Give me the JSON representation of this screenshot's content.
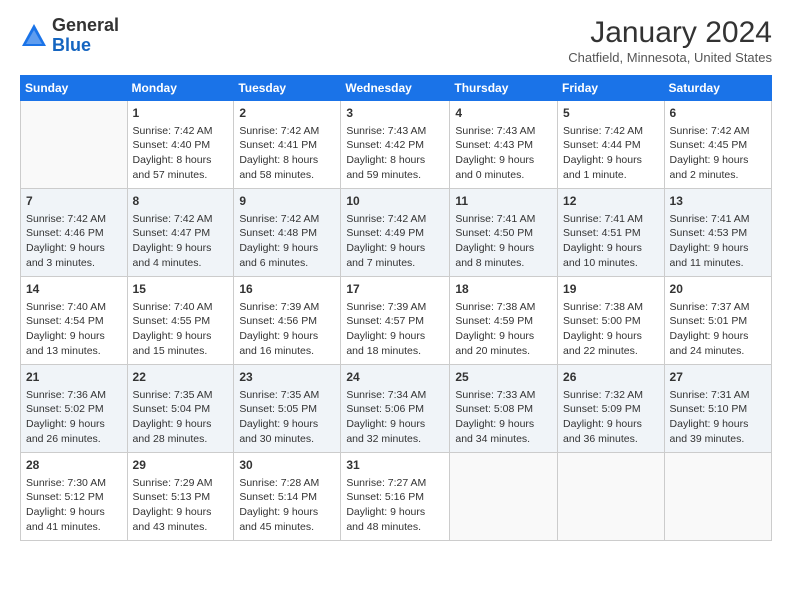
{
  "header": {
    "logo_general": "General",
    "logo_blue": "Blue",
    "month_title": "January 2024",
    "location": "Chatfield, Minnesota, United States"
  },
  "days_of_week": [
    "Sunday",
    "Monday",
    "Tuesday",
    "Wednesday",
    "Thursday",
    "Friday",
    "Saturday"
  ],
  "weeks": [
    [
      {
        "day": "",
        "content": ""
      },
      {
        "day": "1",
        "content": "Sunrise: 7:42 AM\nSunset: 4:40 PM\nDaylight: 8 hours\nand 57 minutes."
      },
      {
        "day": "2",
        "content": "Sunrise: 7:42 AM\nSunset: 4:41 PM\nDaylight: 8 hours\nand 58 minutes."
      },
      {
        "day": "3",
        "content": "Sunrise: 7:43 AM\nSunset: 4:42 PM\nDaylight: 8 hours\nand 59 minutes."
      },
      {
        "day": "4",
        "content": "Sunrise: 7:43 AM\nSunset: 4:43 PM\nDaylight: 9 hours\nand 0 minutes."
      },
      {
        "day": "5",
        "content": "Sunrise: 7:42 AM\nSunset: 4:44 PM\nDaylight: 9 hours\nand 1 minute."
      },
      {
        "day": "6",
        "content": "Sunrise: 7:42 AM\nSunset: 4:45 PM\nDaylight: 9 hours\nand 2 minutes."
      }
    ],
    [
      {
        "day": "7",
        "content": "Sunrise: 7:42 AM\nSunset: 4:46 PM\nDaylight: 9 hours\nand 3 minutes."
      },
      {
        "day": "8",
        "content": "Sunrise: 7:42 AM\nSunset: 4:47 PM\nDaylight: 9 hours\nand 4 minutes."
      },
      {
        "day": "9",
        "content": "Sunrise: 7:42 AM\nSunset: 4:48 PM\nDaylight: 9 hours\nand 6 minutes."
      },
      {
        "day": "10",
        "content": "Sunrise: 7:42 AM\nSunset: 4:49 PM\nDaylight: 9 hours\nand 7 minutes."
      },
      {
        "day": "11",
        "content": "Sunrise: 7:41 AM\nSunset: 4:50 PM\nDaylight: 9 hours\nand 8 minutes."
      },
      {
        "day": "12",
        "content": "Sunrise: 7:41 AM\nSunset: 4:51 PM\nDaylight: 9 hours\nand 10 minutes."
      },
      {
        "day": "13",
        "content": "Sunrise: 7:41 AM\nSunset: 4:53 PM\nDaylight: 9 hours\nand 11 minutes."
      }
    ],
    [
      {
        "day": "14",
        "content": "Sunrise: 7:40 AM\nSunset: 4:54 PM\nDaylight: 9 hours\nand 13 minutes."
      },
      {
        "day": "15",
        "content": "Sunrise: 7:40 AM\nSunset: 4:55 PM\nDaylight: 9 hours\nand 15 minutes."
      },
      {
        "day": "16",
        "content": "Sunrise: 7:39 AM\nSunset: 4:56 PM\nDaylight: 9 hours\nand 16 minutes."
      },
      {
        "day": "17",
        "content": "Sunrise: 7:39 AM\nSunset: 4:57 PM\nDaylight: 9 hours\nand 18 minutes."
      },
      {
        "day": "18",
        "content": "Sunrise: 7:38 AM\nSunset: 4:59 PM\nDaylight: 9 hours\nand 20 minutes."
      },
      {
        "day": "19",
        "content": "Sunrise: 7:38 AM\nSunset: 5:00 PM\nDaylight: 9 hours\nand 22 minutes."
      },
      {
        "day": "20",
        "content": "Sunrise: 7:37 AM\nSunset: 5:01 PM\nDaylight: 9 hours\nand 24 minutes."
      }
    ],
    [
      {
        "day": "21",
        "content": "Sunrise: 7:36 AM\nSunset: 5:02 PM\nDaylight: 9 hours\nand 26 minutes."
      },
      {
        "day": "22",
        "content": "Sunrise: 7:35 AM\nSunset: 5:04 PM\nDaylight: 9 hours\nand 28 minutes."
      },
      {
        "day": "23",
        "content": "Sunrise: 7:35 AM\nSunset: 5:05 PM\nDaylight: 9 hours\nand 30 minutes."
      },
      {
        "day": "24",
        "content": "Sunrise: 7:34 AM\nSunset: 5:06 PM\nDaylight: 9 hours\nand 32 minutes."
      },
      {
        "day": "25",
        "content": "Sunrise: 7:33 AM\nSunset: 5:08 PM\nDaylight: 9 hours\nand 34 minutes."
      },
      {
        "day": "26",
        "content": "Sunrise: 7:32 AM\nSunset: 5:09 PM\nDaylight: 9 hours\nand 36 minutes."
      },
      {
        "day": "27",
        "content": "Sunrise: 7:31 AM\nSunset: 5:10 PM\nDaylight: 9 hours\nand 39 minutes."
      }
    ],
    [
      {
        "day": "28",
        "content": "Sunrise: 7:30 AM\nSunset: 5:12 PM\nDaylight: 9 hours\nand 41 minutes."
      },
      {
        "day": "29",
        "content": "Sunrise: 7:29 AM\nSunset: 5:13 PM\nDaylight: 9 hours\nand 43 minutes."
      },
      {
        "day": "30",
        "content": "Sunrise: 7:28 AM\nSunset: 5:14 PM\nDaylight: 9 hours\nand 45 minutes."
      },
      {
        "day": "31",
        "content": "Sunrise: 7:27 AM\nSunset: 5:16 PM\nDaylight: 9 hours\nand 48 minutes."
      },
      {
        "day": "",
        "content": ""
      },
      {
        "day": "",
        "content": ""
      },
      {
        "day": "",
        "content": ""
      }
    ]
  ]
}
